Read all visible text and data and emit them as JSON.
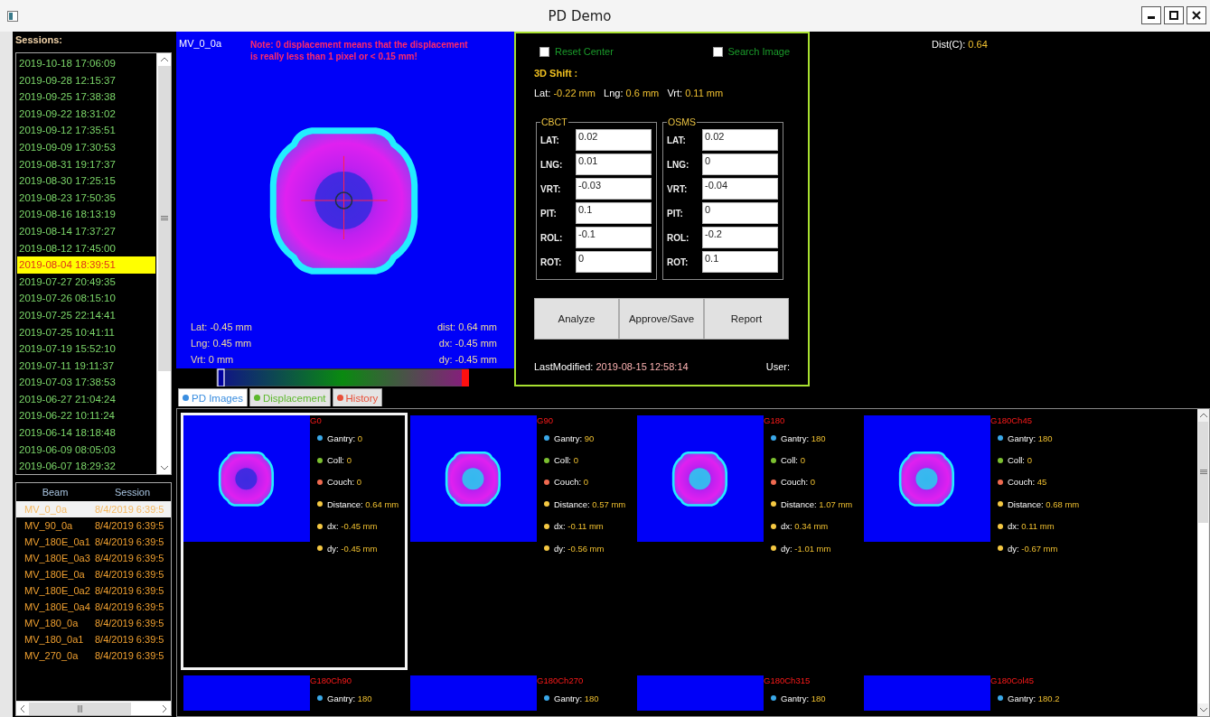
{
  "window": {
    "title": "PD Demo"
  },
  "sessions": {
    "label": "Sessions:",
    "items": [
      {
        "text": "2019-10-18 17:06:09",
        "selected": false
      },
      {
        "text": "2019-09-28 12:15:37",
        "selected": false
      },
      {
        "text": "2019-09-25 17:38:38",
        "selected": false
      },
      {
        "text": "2019-09-22 18:31:02",
        "selected": false
      },
      {
        "text": "2019-09-12 17:35:51",
        "selected": false
      },
      {
        "text": "2019-09-09 17:30:53",
        "selected": false
      },
      {
        "text": "2019-08-31 19:17:37",
        "selected": false
      },
      {
        "text": "2019-08-30 17:25:15",
        "selected": false
      },
      {
        "text": "2019-08-23 17:50:35",
        "selected": false
      },
      {
        "text": "2019-08-16 18:13:19",
        "selected": false
      },
      {
        "text": "2019-08-14 17:37:27",
        "selected": false
      },
      {
        "text": "2019-08-12 17:45:00",
        "selected": false
      },
      {
        "text": "2019-08-04 18:39:51",
        "selected": true
      },
      {
        "text": "2019-07-27 20:49:35",
        "selected": false
      },
      {
        "text": "2019-07-26 08:15:10",
        "selected": false
      },
      {
        "text": "2019-07-25 22:14:41",
        "selected": false
      },
      {
        "text": "2019-07-25 10:41:11",
        "selected": false
      },
      {
        "text": "2019-07-19 15:52:10",
        "selected": false
      },
      {
        "text": "2019-07-11 19:11:37",
        "selected": false
      },
      {
        "text": "2019-07-03 17:38:53",
        "selected": false
      },
      {
        "text": "2019-06-27 21:04:24",
        "selected": false
      },
      {
        "text": "2019-06-22 10:11:24",
        "selected": false
      },
      {
        "text": "2019-06-14 18:18:48",
        "selected": false
      },
      {
        "text": "2019-06-09 08:05:03",
        "selected": false
      },
      {
        "text": "2019-06-07 18:29:32",
        "selected": false
      }
    ]
  },
  "beams": {
    "columns": [
      "Beam",
      "Session"
    ],
    "rows": [
      {
        "beam": "MV_0_0a",
        "session": "8/4/2019 6:39:5",
        "selected": true
      },
      {
        "beam": "MV_90_0a",
        "session": "8/4/2019 6:39:5",
        "selected": false
      },
      {
        "beam": "MV_180E_0a1",
        "session": "8/4/2019 6:39:5",
        "selected": false
      },
      {
        "beam": "MV_180E_0a3",
        "session": "8/4/2019 6:39:5",
        "selected": false
      },
      {
        "beam": "MV_180E_0a",
        "session": "8/4/2019 6:39:5",
        "selected": false
      },
      {
        "beam": "MV_180E_0a2",
        "session": "8/4/2019 6:39:5",
        "selected": false
      },
      {
        "beam": "MV_180E_0a4",
        "session": "8/4/2019 6:39:5",
        "selected": false
      },
      {
        "beam": "MV_180_0a",
        "session": "8/4/2019 6:39:5",
        "selected": false
      },
      {
        "beam": "MV_180_0a1",
        "session": "8/4/2019 6:39:5",
        "selected": false
      },
      {
        "beam": "MV_270_0a",
        "session": "8/4/2019 6:39:5",
        "selected": false
      }
    ]
  },
  "image_view": {
    "beam": "MV_0_0a",
    "note": "Note: 0 displacement means that the displacement is really less than 1 pixel or < 0.15 mm!",
    "left_readings": [
      {
        "label": "Lat:",
        "value": "-0.45 mm"
      },
      {
        "label": "Lng:",
        "value": "0.45 mm"
      },
      {
        "label": "Vrt:",
        "value": "0 mm"
      }
    ],
    "right_readings": [
      {
        "label": "dist:",
        "value": "0.64 mm"
      },
      {
        "label": "dx:",
        "value": "-0.45 mm"
      },
      {
        "label": "dy:",
        "value": "-0.45 mm"
      }
    ]
  },
  "tabs": [
    {
      "label": "PD Images",
      "selected": true,
      "color": "#3a8ee0"
    },
    {
      "label": "Displacement",
      "selected": false,
      "color": "#5cb82c"
    },
    {
      "label": "History",
      "selected": false,
      "color": "#e8503a"
    }
  ],
  "control_panel": {
    "checkboxes": [
      {
        "label": "Reset Center",
        "checked": false
      },
      {
        "label": "Search Image",
        "checked": false
      }
    ],
    "shift_title": "3D Shift :",
    "shift": [
      {
        "label": "Lat:",
        "value": "-0.22 mm"
      },
      {
        "label": "Lng:",
        "value": "0.6 mm"
      },
      {
        "label": "Vrt:",
        "value": "0.11 mm"
      }
    ],
    "groups": [
      {
        "title": "CBCT",
        "fields": [
          {
            "label": "LAT:",
            "value": "0.02"
          },
          {
            "label": "LNG:",
            "value": "0.01"
          },
          {
            "label": "VRT:",
            "value": "-0.03"
          },
          {
            "label": "PIT:",
            "value": "0.1"
          },
          {
            "label": "ROL:",
            "value": "-0.1"
          },
          {
            "label": "ROT:",
            "value": "0"
          }
        ]
      },
      {
        "title": "OSMS",
        "fields": [
          {
            "label": "LAT:",
            "value": "0.02"
          },
          {
            "label": "LNG:",
            "value": "0"
          },
          {
            "label": "VRT:",
            "value": "-0.04"
          },
          {
            "label": "PIT:",
            "value": "0"
          },
          {
            "label": "ROL:",
            "value": "-0.2"
          },
          {
            "label": "ROT:",
            "value": "0.1"
          }
        ]
      }
    ],
    "buttons": [
      "Analyze",
      "Approve/Save",
      "Report"
    ],
    "last_modified": {
      "label": "LastModified:",
      "value": "2019-08-15 12:58:14"
    },
    "user_label": "User:"
  },
  "dist_c": {
    "label": "Dist(C):",
    "value": "0.64"
  },
  "thumbnails": [
    {
      "title": "G0",
      "selected": true,
      "details": [
        {
          "label": "Gantry:",
          "value": "0",
          "color": "#3aa8e8"
        },
        {
          "label": "Coll:",
          "value": "0",
          "color": "#7cc030"
        },
        {
          "label": "Couch:",
          "value": "0",
          "color": "#f06a50"
        },
        {
          "label": "Distance:",
          "value": "0.64 mm",
          "color": "#f5c842"
        },
        {
          "label": "dx:",
          "value": "-0.45 mm",
          "color": "#f5c842"
        },
        {
          "label": "dy:",
          "value": "-0.45 mm",
          "color": "#f5c842"
        }
      ]
    },
    {
      "title": "G90",
      "selected": false,
      "details": [
        {
          "label": "Gantry:",
          "value": "90",
          "color": "#3aa8e8"
        },
        {
          "label": "Coll:",
          "value": "0",
          "color": "#7cc030"
        },
        {
          "label": "Couch:",
          "value": "0",
          "color": "#f06a50"
        },
        {
          "label": "Distance:",
          "value": "0.57 mm",
          "color": "#f5c842"
        },
        {
          "label": "dx:",
          "value": "-0.11 mm",
          "color": "#f5c842"
        },
        {
          "label": "dy:",
          "value": "-0.56 mm",
          "color": "#f5c842"
        }
      ]
    },
    {
      "title": "G180",
      "selected": false,
      "details": [
        {
          "label": "Gantry:",
          "value": "180",
          "color": "#3aa8e8"
        },
        {
          "label": "Coll:",
          "value": "0",
          "color": "#7cc030"
        },
        {
          "label": "Couch:",
          "value": "0",
          "color": "#f06a50"
        },
        {
          "label": "Distance:",
          "value": "1.07 mm",
          "color": "#f5c842"
        },
        {
          "label": "dx:",
          "value": "0.34 mm",
          "color": "#f5c842"
        },
        {
          "label": "dy:",
          "value": "-1.01 mm",
          "color": "#f5c842"
        }
      ]
    },
    {
      "title": "G180Ch45",
      "selected": false,
      "details": [
        {
          "label": "Gantry:",
          "value": "180",
          "color": "#3aa8e8"
        },
        {
          "label": "Coll:",
          "value": "0",
          "color": "#7cc030"
        },
        {
          "label": "Couch:",
          "value": "45",
          "color": "#f06a50"
        },
        {
          "label": "Distance:",
          "value": "0.68 mm",
          "color": "#f5c842"
        },
        {
          "label": "dx:",
          "value": "0.11 mm",
          "color": "#f5c842"
        },
        {
          "label": "dy:",
          "value": "-0.67 mm",
          "color": "#f5c842"
        }
      ]
    },
    {
      "title": "G180Ch90",
      "selected": false,
      "details": [
        {
          "label": "Gantry:",
          "value": "180",
          "color": "#3aa8e8"
        }
      ]
    },
    {
      "title": "G180Ch270",
      "selected": false,
      "details": [
        {
          "label": "Gantry:",
          "value": "180",
          "color": "#3aa8e8"
        }
      ]
    },
    {
      "title": "G180Ch315",
      "selected": false,
      "details": [
        {
          "label": "Gantry:",
          "value": "180",
          "color": "#3aa8e8"
        }
      ]
    },
    {
      "title": "G180Col45",
      "selected": false,
      "details": [
        {
          "label": "Gantry:",
          "value": "180.2",
          "color": "#3aa8e8"
        }
      ]
    }
  ]
}
